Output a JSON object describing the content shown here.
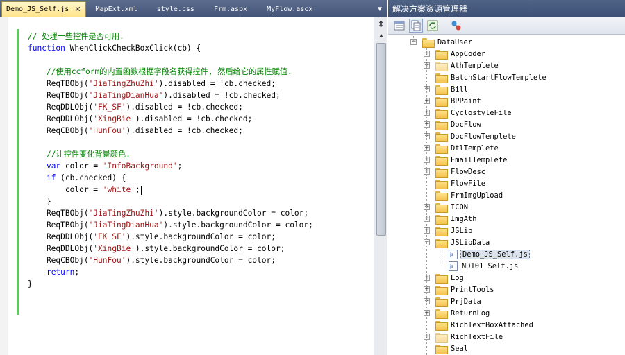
{
  "editor": {
    "tabs": [
      {
        "label": "Demo_JS_Self.js",
        "active": true
      },
      {
        "label": "MapExt.xml"
      },
      {
        "label": "style.css"
      },
      {
        "label": "Frm.aspx"
      },
      {
        "label": "MyFlow.ascx"
      }
    ],
    "close_glyph": "✕",
    "dropdown_glyph": "▼",
    "code_lines": [
      [
        {
          "t": "// 处理一些控件是否可用.",
          "c": "cm"
        }
      ],
      [
        {
          "t": "function",
          "c": "kw"
        },
        {
          "t": " WhenClickCheckBoxClick(cb) {"
        }
      ],
      [],
      [
        {
          "t": "    "
        },
        {
          "t": "//使用ccform的内置函数根据字段名获得控件, 然后给它的属性赋值.",
          "c": "cm"
        }
      ],
      [
        {
          "t": "    ReqTBObj("
        },
        {
          "t": "'JiaTingZhuZhi'",
          "c": "st"
        },
        {
          "t": ").disabled = !cb.checked;"
        }
      ],
      [
        {
          "t": "    ReqTBObj("
        },
        {
          "t": "'JiaTingDianHua'",
          "c": "st"
        },
        {
          "t": ").disabled = !cb.checked;"
        }
      ],
      [
        {
          "t": "    ReqDDLObj("
        },
        {
          "t": "'FK_SF'",
          "c": "st"
        },
        {
          "t": ").disabled = !cb.checked;"
        }
      ],
      [
        {
          "t": "    ReqDDLObj("
        },
        {
          "t": "'XingBie'",
          "c": "st"
        },
        {
          "t": ").disabled = !cb.checked;"
        }
      ],
      [
        {
          "t": "    ReqCBObj("
        },
        {
          "t": "'HunFou'",
          "c": "st"
        },
        {
          "t": ").disabled = !cb.checked;"
        }
      ],
      [],
      [
        {
          "t": "    "
        },
        {
          "t": "//让控件变化背景颜色.",
          "c": "cm"
        }
      ],
      [
        {
          "t": "    "
        },
        {
          "t": "var",
          "c": "kw"
        },
        {
          "t": " color = "
        },
        {
          "t": "'InfoBackground'",
          "c": "st"
        },
        {
          "t": ";"
        }
      ],
      [
        {
          "t": "    "
        },
        {
          "t": "if",
          "c": "kw"
        },
        {
          "t": " (cb.checked) {"
        }
      ],
      [
        {
          "t": "        color = "
        },
        {
          "t": "'white'",
          "c": "st"
        },
        {
          "t": ";"
        },
        {
          "caret": true
        }
      ],
      [
        {
          "t": "    }"
        }
      ],
      [
        {
          "t": "    ReqTBObj("
        },
        {
          "t": "'JiaTingZhuZhi'",
          "c": "st"
        },
        {
          "t": ").style.backgroundColor = color;"
        }
      ],
      [
        {
          "t": "    ReqTBObj("
        },
        {
          "t": "'JiaTingDianHua'",
          "c": "st"
        },
        {
          "t": ").style.backgroundColor = color;"
        }
      ],
      [
        {
          "t": "    ReqDDLObj("
        },
        {
          "t": "'FK_SF'",
          "c": "st"
        },
        {
          "t": ").style.backgroundColor = color;"
        }
      ],
      [
        {
          "t": "    ReqDDLObj("
        },
        {
          "t": "'XingBie'",
          "c": "st"
        },
        {
          "t": ").style.backgroundColor = color;"
        }
      ],
      [
        {
          "t": "    ReqCBObj("
        },
        {
          "t": "'HunFou'",
          "c": "st"
        },
        {
          "t": ").style.backgroundColor = color;"
        }
      ],
      [
        {
          "t": "    "
        },
        {
          "t": "return",
          "c": "kw"
        },
        {
          "t": ";"
        }
      ],
      [
        {
          "t": "}"
        }
      ]
    ],
    "scroll_split_glyph": "⇕",
    "scroll_up_glyph": "▲"
  },
  "explorer": {
    "title": "解决方案资源管理器",
    "toolbar_icons": [
      "properties-icon",
      "show-all-files-icon",
      "refresh-icon",
      "class-diagram-icon"
    ],
    "tree": [
      {
        "label": "DataUser",
        "depth": 0,
        "type": "folder",
        "expander": "−"
      },
      {
        "label": "AppCoder",
        "depth": 1,
        "type": "folder",
        "expander": "+"
      },
      {
        "label": "AthTemplete",
        "depth": 1,
        "type": "folder-empty",
        "expander": "+"
      },
      {
        "label": "BatchStartFlowTemplete",
        "depth": 1,
        "type": "folder",
        "expander": ""
      },
      {
        "label": "Bill",
        "depth": 1,
        "type": "folder",
        "expander": "+"
      },
      {
        "label": "BPPaint",
        "depth": 1,
        "type": "folder",
        "expander": "+"
      },
      {
        "label": "CyclostyleFile",
        "depth": 1,
        "type": "folder",
        "expander": "+"
      },
      {
        "label": "DocFlow",
        "depth": 1,
        "type": "folder",
        "expander": "+"
      },
      {
        "label": "DocFlowTemplete",
        "depth": 1,
        "type": "folder",
        "expander": "+"
      },
      {
        "label": "DtlTemplete",
        "depth": 1,
        "type": "folder",
        "expander": "+"
      },
      {
        "label": "EmailTemplete",
        "depth": 1,
        "type": "folder",
        "expander": "+"
      },
      {
        "label": "FlowDesc",
        "depth": 1,
        "type": "folder",
        "expander": "+"
      },
      {
        "label": "FlowFile",
        "depth": 1,
        "type": "folder",
        "expander": ""
      },
      {
        "label": "FrmImgUpload",
        "depth": 1,
        "type": "folder",
        "expander": ""
      },
      {
        "label": "ICON",
        "depth": 1,
        "type": "folder",
        "expander": "+"
      },
      {
        "label": "ImgAth",
        "depth": 1,
        "type": "folder",
        "expander": "+"
      },
      {
        "label": "JSLib",
        "depth": 1,
        "type": "folder",
        "expander": "+"
      },
      {
        "label": "JSLibData",
        "depth": 1,
        "type": "folder-open",
        "expander": "−"
      },
      {
        "label": "Demo_JS_Self.js",
        "depth": 2,
        "type": "file",
        "expander": "",
        "selected": true
      },
      {
        "label": "ND101_Self.js",
        "depth": 2,
        "type": "file",
        "expander": ""
      },
      {
        "label": "Log",
        "depth": 1,
        "type": "folder",
        "expander": "+"
      },
      {
        "label": "PrintTools",
        "depth": 1,
        "type": "folder",
        "expander": "+"
      },
      {
        "label": "PrjData",
        "depth": 1,
        "type": "folder",
        "expander": "+"
      },
      {
        "label": "ReturnLog",
        "depth": 1,
        "type": "folder",
        "expander": "+"
      },
      {
        "label": "RichTextBoxAttached",
        "depth": 1,
        "type": "folder",
        "expander": ""
      },
      {
        "label": "RichTextFile",
        "depth": 1,
        "type": "folder-empty",
        "expander": "+"
      },
      {
        "label": "Seal",
        "depth": 1,
        "type": "folder",
        "expander": ""
      }
    ]
  }
}
